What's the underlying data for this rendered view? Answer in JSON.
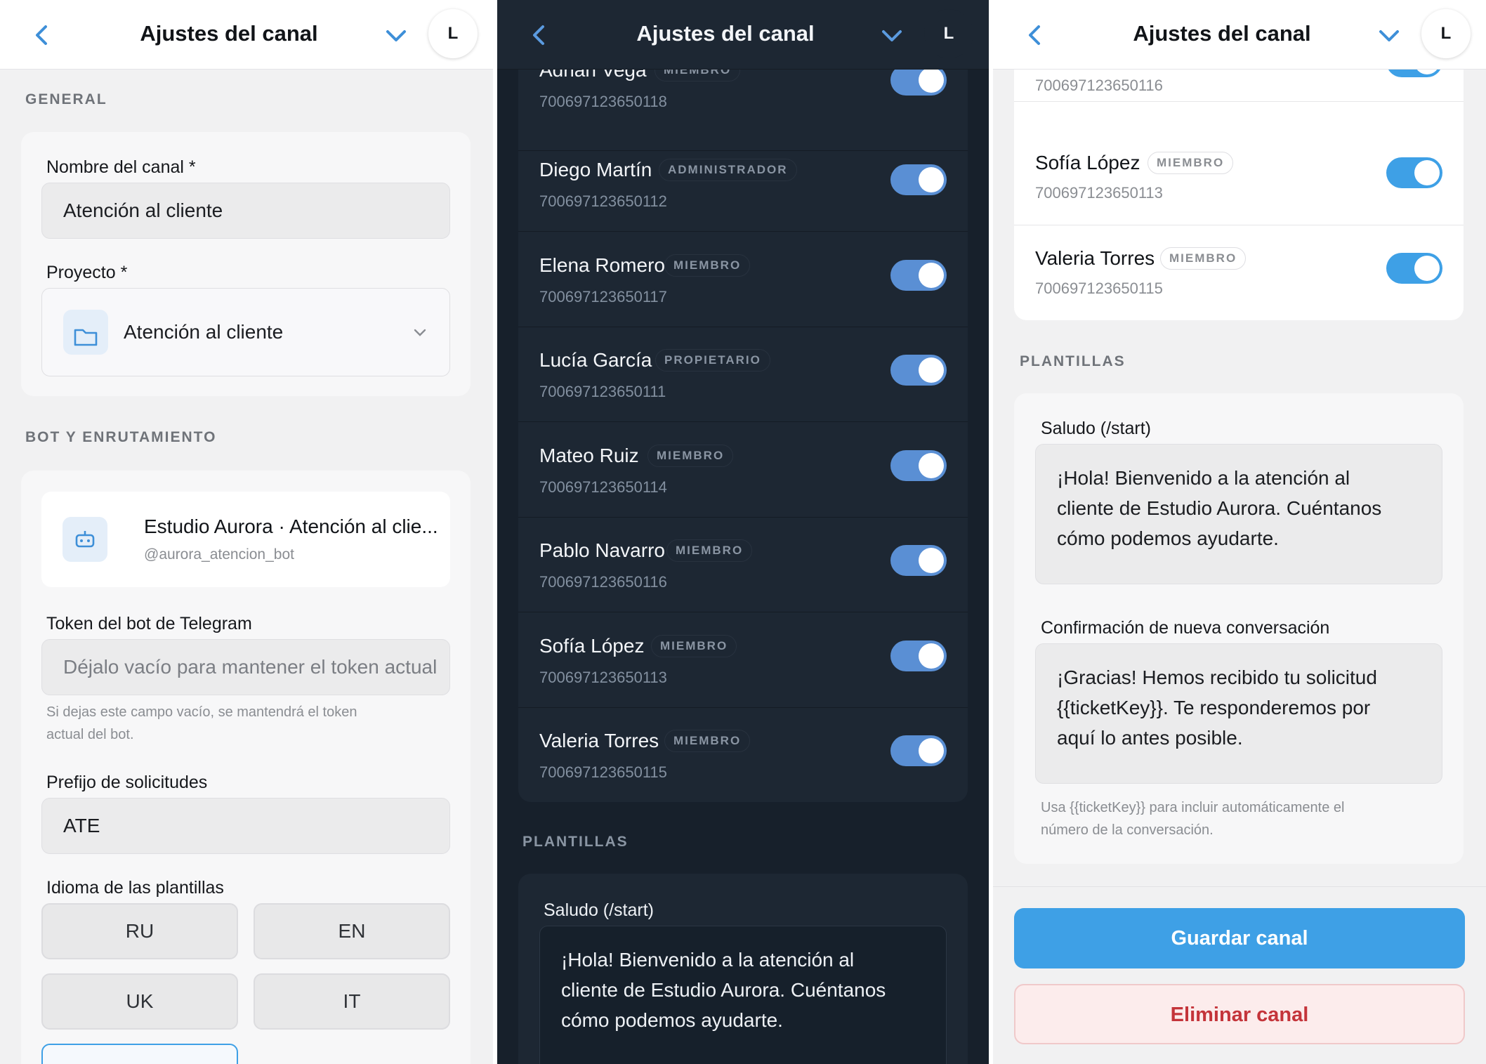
{
  "header": {
    "title": "Ajustes del canal",
    "avatar_letter": "L"
  },
  "general": {
    "section_label": "GENERAL",
    "channel_name_label": "Nombre del canal *",
    "channel_name_value": "Atención al cliente",
    "project_label": "Proyecto *",
    "project_value": "Atención al cliente"
  },
  "bot": {
    "section_label": "BOT Y ENRUTAMIENTO",
    "bot_name": "Estudio Aurora · Atención al clie...",
    "bot_handle": "@aurora_atencion_bot",
    "token_label": "Token del bot de Telegram",
    "token_placeholder": "Déjalo vacío para mantener el token actual",
    "token_hint_line1": "Si dejas este campo vacío, se mantendrá el token",
    "token_hint_line2": "actual del bot.",
    "prefix_label": "Prefijo de solicitudes",
    "prefix_value": "ATE",
    "language_label": "Idioma de las plantillas",
    "languages": [
      "RU",
      "EN",
      "UK",
      "IT"
    ]
  },
  "members": [
    {
      "name": "Adrián Vega",
      "role": "MIEMBRO",
      "id": "700697123650118",
      "enabled": true
    },
    {
      "name": "Diego Martín",
      "role": "ADMINISTRADOR",
      "id": "700697123650112",
      "enabled": true
    },
    {
      "name": "Elena Romero",
      "role": "MIEMBRO",
      "id": "700697123650117",
      "enabled": true
    },
    {
      "name": "Lucía García",
      "role": "PROPIETARIO",
      "id": "700697123650111",
      "enabled": true
    },
    {
      "name": "Mateo Ruiz",
      "role": "MIEMBRO",
      "id": "700697123650114",
      "enabled": true
    },
    {
      "name": "Pablo Navarro",
      "role": "MIEMBRO",
      "id": "700697123650116",
      "enabled": true
    },
    {
      "name": "Sofía López",
      "role": "MIEMBRO",
      "id": "700697123650113",
      "enabled": true
    },
    {
      "name": "Valeria Torres",
      "role": "MIEMBRO",
      "id": "700697123650115",
      "enabled": true
    }
  ],
  "templates": {
    "section_label": "PLANTILLAS",
    "greeting_label": "Saludo (/start)",
    "greeting_line1": "¡Hola! Bienvenido a la atención al",
    "greeting_line2": "cliente de Estudio Aurora. Cuéntanos",
    "greeting_line3": "cómo podemos ayudarte.",
    "confirm_label": "Confirmación de nueva conversación",
    "confirm_line1": "¡Gracias! Hemos recibido tu solicitud",
    "confirm_line2": "{{ticketKey}}. Te responderemos por",
    "confirm_line3": "aquí lo antes posible.",
    "hint_line1": "Usa {{ticketKey}} para incluir automáticamente el",
    "hint_line2": "número de la conversación."
  },
  "actions": {
    "save_label": "Guardar canal",
    "delete_label": "Eliminar canal"
  },
  "colors": {
    "accent": "#3ea0e6",
    "danger": "#c4343a",
    "danger_bg": "#fcecec",
    "dark_bg": "#17202b"
  }
}
